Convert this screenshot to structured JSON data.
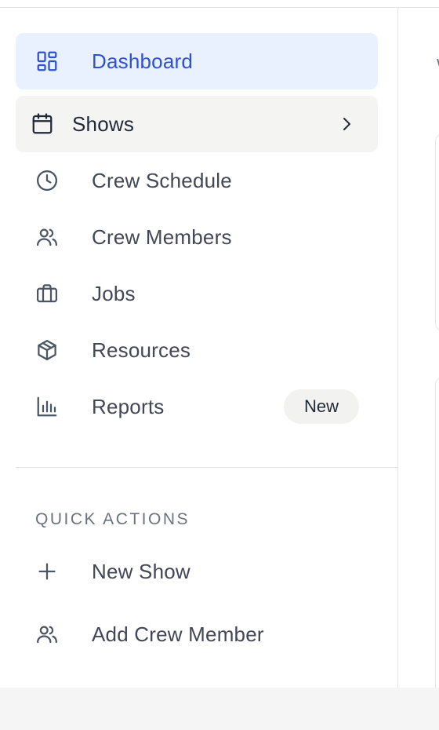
{
  "nav": {
    "items": [
      {
        "label": "Dashboard",
        "icon": "dashboard-icon",
        "state": "active"
      },
      {
        "label": "Shows",
        "icon": "calendar-icon",
        "state": "hover"
      },
      {
        "label": "Crew Schedule",
        "icon": "clock-icon"
      },
      {
        "label": "Crew Members",
        "icon": "users-icon"
      },
      {
        "label": "Jobs",
        "icon": "briefcase-icon"
      },
      {
        "label": "Resources",
        "icon": "package-icon"
      },
      {
        "label": "Reports",
        "icon": "bar-chart-icon",
        "badge": "New"
      }
    ]
  },
  "quick_actions": {
    "title": "QUICK ACTIONS",
    "items": [
      {
        "label": "New Show",
        "icon": "plus-icon"
      },
      {
        "label": "Add Crew Member",
        "icon": "users-icon"
      }
    ]
  },
  "main": {
    "partial_text": "W"
  },
  "colors": {
    "accent": "#2f51cf",
    "active_bg": "#e8f1fd",
    "hover_bg": "#f4f4f3",
    "text": "#414756",
    "muted": "#6b7280"
  }
}
